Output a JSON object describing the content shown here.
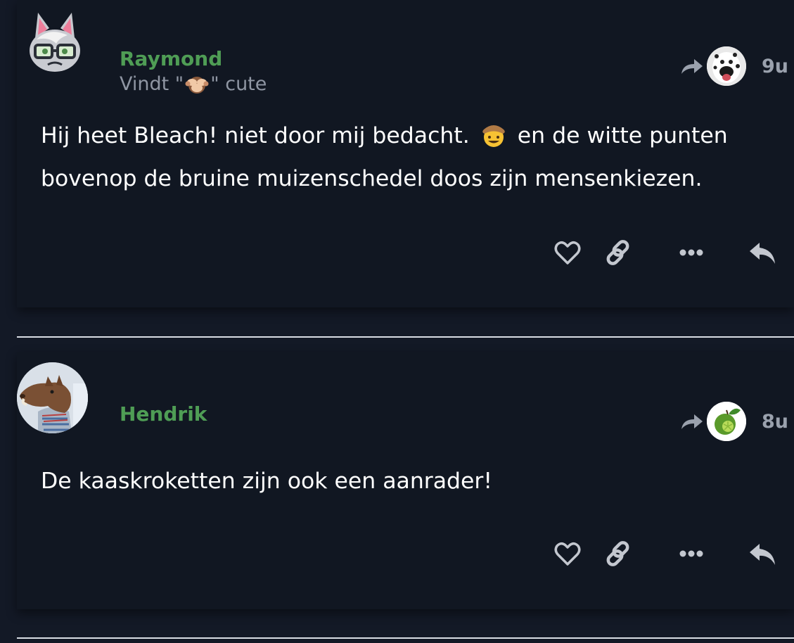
{
  "posts": [
    {
      "author": "Raymond",
      "subtitle_prefix": "Vindt \"",
      "subtitle_suffix": "\" cute",
      "time": "9u",
      "body_part1": "Hij heet Bleach! niet door mij bedacht.",
      "body_part2": "en de witte punten bovenop de bruine muizenschedel doos zijn mensenkiezen."
    },
    {
      "author": "Hendrik",
      "time": "8u",
      "body": "De kaaskroketten zijn ook een aanrader!"
    }
  ],
  "icons": {
    "share": "share-arrow-icon",
    "like": "heart-icon",
    "link": "link-icon",
    "more": "ellipsis-icon",
    "reply": "reply-icon"
  },
  "colors": {
    "background": "#131926",
    "card": "#111722",
    "username": "#4f9d55",
    "muted": "#8f96a3",
    "icon": "#c3c7cf"
  }
}
